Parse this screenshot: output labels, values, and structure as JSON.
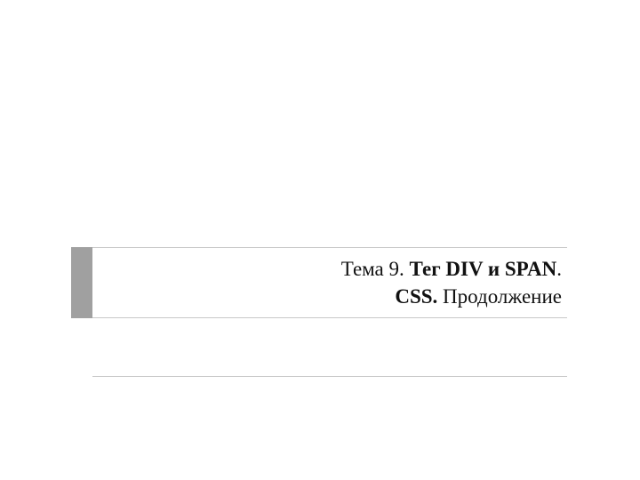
{
  "slide": {
    "title_prefix": "Тема 9. ",
    "title_bold_1": "Тег DIV и SPAN",
    "title_dot": ".",
    "title_line2_bold": "CSS. ",
    "title_line2_rest": "Продолжение"
  }
}
